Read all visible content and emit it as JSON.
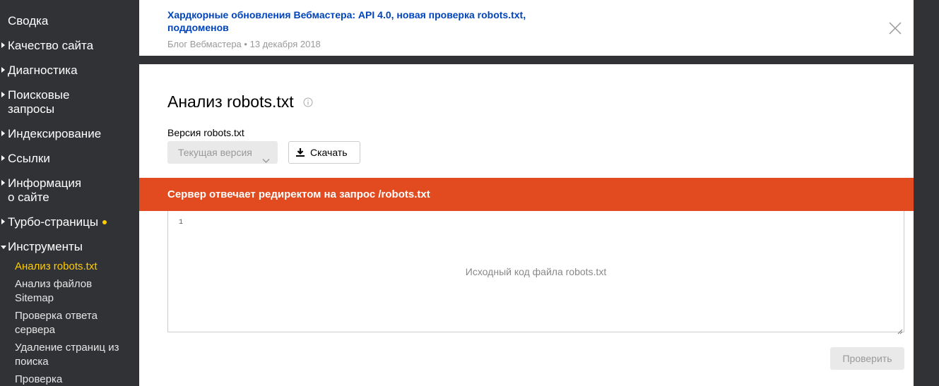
{
  "sidebar": {
    "items": [
      {
        "label": "Сводка",
        "has_arrow": false
      },
      {
        "label": "Качество сайта",
        "has_arrow": true
      },
      {
        "label": "Диагностика",
        "has_arrow": true
      },
      {
        "label": "Поисковые запросы",
        "line1": "Поисковые",
        "line2": "запросы",
        "has_arrow": true
      },
      {
        "label": "Индексирование",
        "has_arrow": true
      },
      {
        "label": "Ссылки",
        "has_arrow": true
      },
      {
        "label": "Информация о сайте",
        "line1": "Информация",
        "line2": "о сайте",
        "has_arrow": true
      },
      {
        "label": "Турбо-страницы",
        "has_arrow": true,
        "badge": "dot"
      },
      {
        "label": "Инструменты",
        "has_arrow": true,
        "expanded": true
      }
    ],
    "tools_subitems": [
      {
        "label": "Анализ robots.txt",
        "active": true
      },
      {
        "label": "Анализ файлов Sitemap",
        "line1": "Анализ файлов",
        "line2": "Sitemap"
      },
      {
        "label": "Проверка ответа сервера",
        "line1": "Проверка ответа",
        "line2": "сервера"
      },
      {
        "label": "Удаление страниц из поиска",
        "line1": "Удаление страниц из",
        "line2": "поиска"
      },
      {
        "label": "Проверка"
      }
    ],
    "accent_color": "#ffcc00"
  },
  "notice": {
    "title_line1": "Хардкорные обновления Вебмастера: API 4.0, новая проверка robots.txt,",
    "title_line2": "поддоменов",
    "source": "Блог Вебмастера",
    "separator": "•",
    "date": "13 декабря 2018",
    "close_icon": "close-icon"
  },
  "main": {
    "title": "Анализ robots.txt",
    "version_label": "Версия robots.txt",
    "version_select": "Текущая версия",
    "download_label": "Скачать",
    "error_message": "Сервер отвечает редиректом на запрос /robots.txt",
    "error_color": "#e24b1f",
    "editor_line": "1",
    "editor_placeholder": "Исходный код файла robots.txt",
    "check_label": "Проверить"
  }
}
